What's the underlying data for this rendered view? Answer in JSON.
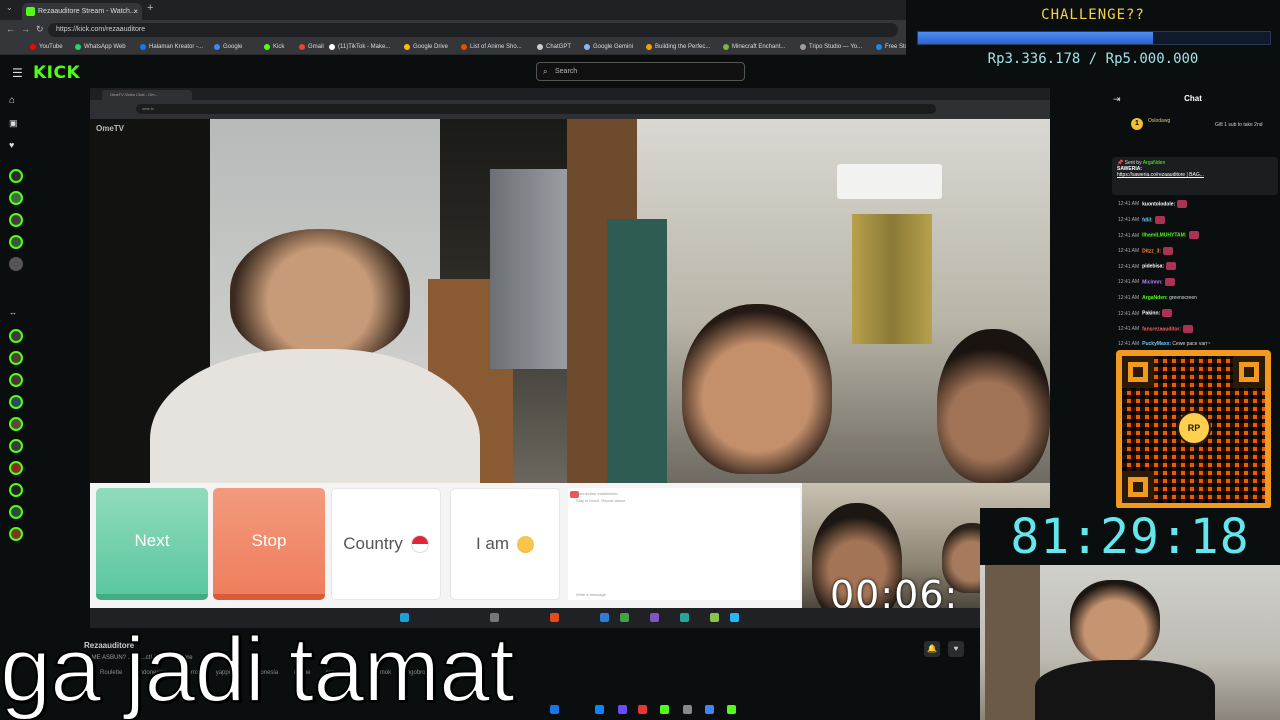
{
  "browser": {
    "tab_title": "Rezaauditore Stream - Watch...",
    "new_tab": "+",
    "tab_close": "×",
    "url": "https://kick.com/rezaauditore",
    "bookmarks": [
      {
        "label": "YouTube",
        "color": "#ff0000"
      },
      {
        "label": "WhatsApp Web",
        "color": "#25d366"
      },
      {
        "label": "Halaman Kreator -...",
        "color": "#1877f2"
      },
      {
        "label": "Google",
        "color": "#4285f4"
      },
      {
        "label": "Kick",
        "color": "#53fc18"
      },
      {
        "label": "Gmail",
        "color": "#ea4335"
      },
      {
        "label": "(11)TikTok - Make...",
        "color": "#ffffff"
      },
      {
        "label": "Google Drive",
        "color": "#fbbc04"
      },
      {
        "label": "List of Anime Sho...",
        "color": "#e65100"
      },
      {
        "label": "ChatGPT",
        "color": "#cccccc"
      },
      {
        "label": "Google Gemini",
        "color": "#8ab4f8"
      },
      {
        "label": "Building the Perfec...",
        "color": "#f59f00"
      },
      {
        "label": "Minecraft Enchant...",
        "color": "#7cb342"
      },
      {
        "label": "Tripo Studio — Yo...",
        "color": "#9e9e9e"
      },
      {
        "label": "Free Sto...",
        "color": "#1e88e5"
      }
    ]
  },
  "kick": {
    "logo": "KICK",
    "search_placeholder": "Search"
  },
  "challenge": {
    "title": "CHALLENGE??",
    "progress": 0.667,
    "amount": "Rp3.336.178 / Rp5.000.000"
  },
  "videochat": {
    "tab_title": "OmeTV Video Chat - Om...",
    "url": "ome.tv",
    "watermark": "OmeTV",
    "buttons": {
      "next": "Next",
      "stop": "Stop",
      "country": "Country",
      "iam": "I am"
    },
    "chat_lines": [
      "Connection established",
      "Stay in touch. Report abuse"
    ],
    "chat_placeholder": "Write a message",
    "self_timer": "00:06:"
  },
  "chat": {
    "title": "Chat",
    "pinned_sub": {
      "name": "Oslodawg",
      "gift": "Gift 1 sub to take 2nd"
    },
    "pinned_message": {
      "sent_by": "Sent by",
      "sender": "ArgaNden",
      "heading": "SAWERIA:",
      "link": "https://saweria.co/rezaauditore | BAG..."
    },
    "messages": [
      {
        "time": "12:41 AM",
        "user": "kuontolodole:",
        "color": "#ffffff",
        "text": ""
      },
      {
        "time": "12:41 AM",
        "user": "fdlil:",
        "color": "#6fc5ff",
        "text": ""
      },
      {
        "time": "12:41 AM",
        "user": "IlhamILMUHYTAM:",
        "color": "#53fc18",
        "text": ""
      },
      {
        "time": "12:41 AM",
        "user": "Ditzz_3:",
        "color": "#ff8a3d",
        "text": ""
      },
      {
        "time": "12:41 AM",
        "user": "pidebisa:",
        "color": "#ffffff",
        "text": ""
      },
      {
        "time": "12:41 AM",
        "user": "Micinnn:",
        "color": "#b286ff",
        "text": ""
      },
      {
        "time": "12:41 AM",
        "user": "ArgaNden:",
        "color": "#53fc18",
        "text": "greenscreen"
      },
      {
        "time": "12:41 AM",
        "user": "Pakinn:",
        "color": "#ffffff",
        "text": ""
      },
      {
        "time": "12:41 AM",
        "user": "fansrezaauditor:",
        "color": "#ff5b5b",
        "text": ""
      },
      {
        "time": "12:41 AM",
        "user": "PuckyMaxx:",
        "color": "#6fc5ff",
        "text": "Cewe pace varr~"
      }
    ]
  },
  "qr_logo": "RP",
  "big_timer": "81:29:18",
  "stream": {
    "streamer": "Rezaauditore",
    "title": "DI ME ASBUN? ... tv ...ct! | Rezaauditore",
    "tags": [
      "Roulette",
      "Indonesian",
      "Horror",
      "yapping",
      "indonesia",
      "meme",
      "rezaauditore",
      "jomok",
      "ngobrol"
    ]
  },
  "caption": "ga jadi tamat"
}
